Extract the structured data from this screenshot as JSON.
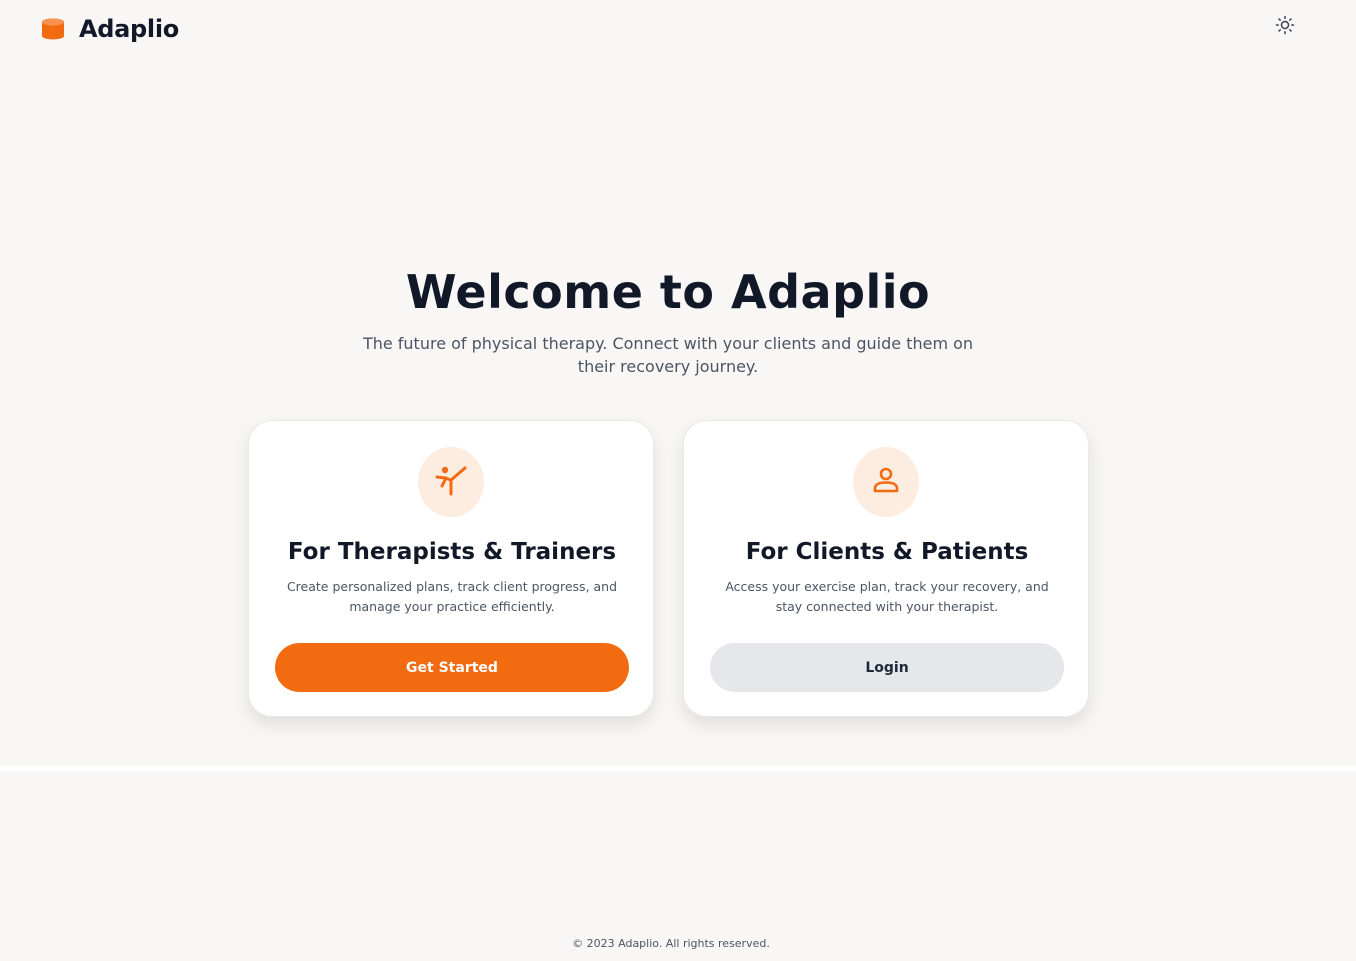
{
  "header": {
    "brand": "Adaplio",
    "logo_icon": "database-icon",
    "theme_toggle_icon": "sun-icon"
  },
  "hero": {
    "title": "Welcome to Adaplio",
    "subtitle": "The future of physical therapy. Connect with your clients and guide them on their recovery journey."
  },
  "cards": [
    {
      "icon": "stretching-person-icon",
      "title": "For Therapists & Trainers",
      "description": "Create personalized plans, track client progress, and manage your practice efficiently.",
      "button_label": "Get Started"
    },
    {
      "icon": "user-icon",
      "title": "For Clients & Patients",
      "description": "Access your exercise plan, track your recovery, and stay connected with your therapist.",
      "button_label": "Login"
    }
  ],
  "footer": {
    "text": "© 2023 Adaplio. All rights reserved."
  },
  "colors": {
    "accent": "#f26b11",
    "background": "#f8f7f5",
    "card_background": "#ffffff",
    "icon_circle": "#fdece0",
    "text_primary": "#111827",
    "text_secondary": "#4b5563",
    "secondary_button": "#e5e7eb"
  }
}
